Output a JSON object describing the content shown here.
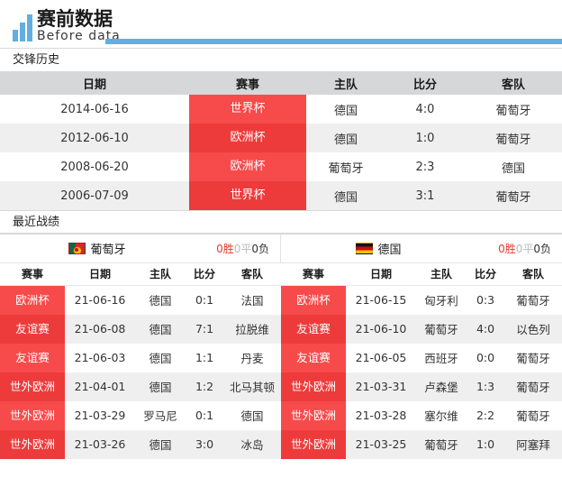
{
  "brand": {
    "name_cn": "赛前数据",
    "name_en": "Before data",
    "accent_color": "#63aee0"
  },
  "h2h": {
    "title": "交锋历史",
    "columns": [
      "日期",
      "赛事",
      "主队",
      "比分",
      "客队"
    ],
    "rows": [
      {
        "date": "2014-06-16",
        "comp": "世界杯",
        "home": "德国",
        "score": "4:0",
        "away": "葡萄牙"
      },
      {
        "date": "2012-06-10",
        "comp": "欧洲杯",
        "home": "德国",
        "score": "1:0",
        "away": "葡萄牙"
      },
      {
        "date": "2008-06-20",
        "comp": "欧洲杯",
        "home": "葡萄牙",
        "score": "2:3",
        "away": "德国"
      },
      {
        "date": "2006-07-09",
        "comp": "世界杯",
        "home": "德国",
        "score": "3:1",
        "away": "葡萄牙"
      }
    ]
  },
  "recent": {
    "title": "最近战绩",
    "columns": [
      "赛事",
      "日期",
      "主队",
      "比分",
      "客队"
    ],
    "left": {
      "team": "葡萄牙",
      "flag": "portugal-flag",
      "record": {
        "win": "0胜",
        "draw": "0平",
        "loss": "0负"
      },
      "rows": [
        {
          "comp": "欧洲杯",
          "date": "21-06-16",
          "home": "德国",
          "score": "0:1",
          "away": "法国"
        },
        {
          "comp": "友谊赛",
          "date": "21-06-08",
          "home": "德国",
          "score": "7:1",
          "away": "拉脱维"
        },
        {
          "comp": "友谊赛",
          "date": "21-06-03",
          "home": "德国",
          "score": "1:1",
          "away": "丹麦"
        },
        {
          "comp": "世外欧洲",
          "date": "21-04-01",
          "home": "德国",
          "score": "1:2",
          "away": "北马其顿"
        },
        {
          "comp": "世外欧洲",
          "date": "21-03-29",
          "home": "罗马尼",
          "score": "0:1",
          "away": "德国"
        },
        {
          "comp": "世外欧洲",
          "date": "21-03-26",
          "home": "德国",
          "score": "3:0",
          "away": "冰岛"
        }
      ]
    },
    "right": {
      "team": "德国",
      "flag": "germany-flag",
      "record": {
        "win": "0胜",
        "draw": "0平",
        "loss": "0负"
      },
      "rows": [
        {
          "comp": "欧洲杯",
          "date": "21-06-15",
          "home": "匈牙利",
          "score": "0:3",
          "away": "葡萄牙"
        },
        {
          "comp": "友谊赛",
          "date": "21-06-10",
          "home": "葡萄牙",
          "score": "4:0",
          "away": "以色列"
        },
        {
          "comp": "友谊赛",
          "date": "21-06-05",
          "home": "西班牙",
          "score": "0:0",
          "away": "葡萄牙"
        },
        {
          "comp": "世外欧洲",
          "date": "21-03-31",
          "home": "卢森堡",
          "score": "1:3",
          "away": "葡萄牙"
        },
        {
          "comp": "世外欧洲",
          "date": "21-03-28",
          "home": "塞尔维",
          "score": "2:2",
          "away": "葡萄牙"
        },
        {
          "comp": "世外欧洲",
          "date": "21-03-25",
          "home": "葡萄牙",
          "score": "1:0",
          "away": "阿塞拜"
        }
      ]
    }
  },
  "colors": {
    "badge_light": "#f74a4a",
    "badge_dark": "#ed3b3b",
    "header_bg": "#d5d7d8",
    "row_alt": "#efefef",
    "win": "#e8372e",
    "draw": "#b9b9b9",
    "loss": "#2f2f2f"
  }
}
